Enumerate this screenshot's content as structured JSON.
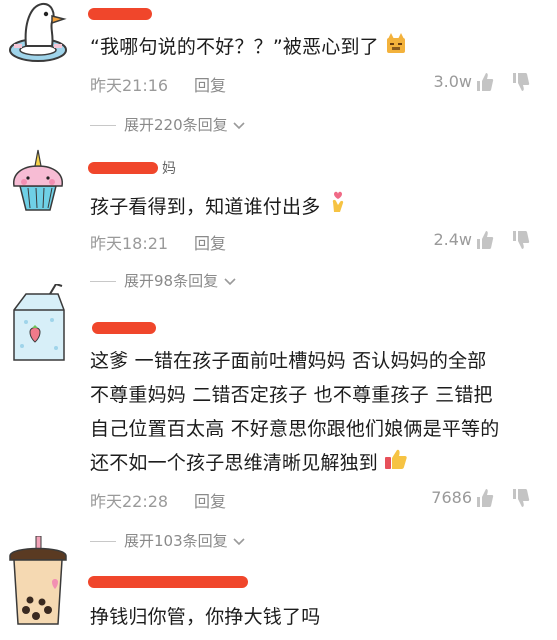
{
  "colors": {
    "name_redaction": "#f0462b",
    "meta": "#9a9a9a",
    "text": "#1c1c1c"
  },
  "comments": [
    {
      "name_tail": "",
      "text_lines": [
        "“我哪句说的不好？？”被恶心到了"
      ],
      "time": "昨天21:16",
      "reply": "回复",
      "likes": "3.0w",
      "expand": "展开220条回复",
      "avatar_icon": "duck-float-icon",
      "emoji_icon": "cat-emoji-icon"
    },
    {
      "name_tail": "妈",
      "text_lines": [
        "孩子看得到，知道谁付出多"
      ],
      "time": "昨天18:21",
      "reply": "回复",
      "likes": "2.4w",
      "expand": "展开98条回复",
      "avatar_icon": "cupcake-unicorn-icon",
      "emoji_icon": "love-hand-emoji-icon"
    },
    {
      "name_tail": "",
      "text_lines": [
        "这爹 一错在孩子面前吐槽妈妈 否认妈妈的全部",
        "不尊重妈妈 二错否定孩子 也不尊重孩子 三错把",
        "自己位置百太高 不好意思你跟他们娘俩是平等的",
        "还不如一个孩子思维清晰见解独到"
      ],
      "time": "昨天22:28",
      "reply": "回复",
      "likes": "7686",
      "expand": "展开103条回复",
      "avatar_icon": "milk-carton-icon",
      "emoji_icon": "thumbs-up-emoji-icon"
    },
    {
      "name_tail": "",
      "text_lines": [
        "挣钱归你管，你挣大钱了吗"
      ],
      "avatar_icon": "bubble-tea-icon"
    }
  ]
}
